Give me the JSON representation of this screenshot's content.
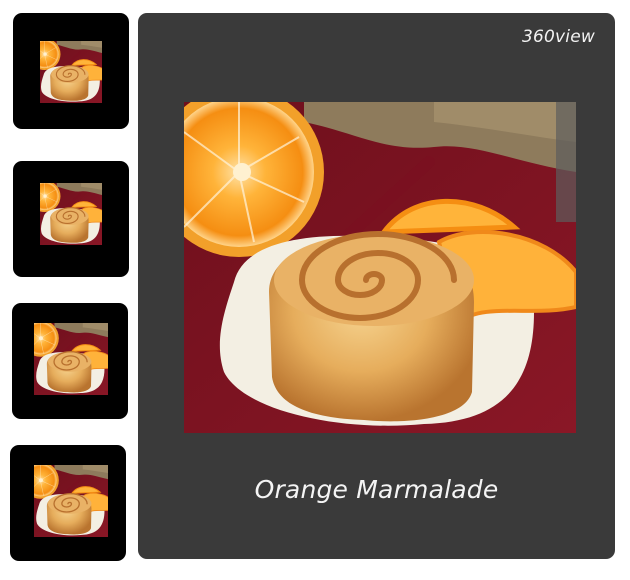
{
  "viewer": {
    "brand_label": "360view",
    "caption": "Orange Marmalade",
    "background_color": "#3a3a3a"
  },
  "thumbnails": [
    {
      "image": "orange-marmalade-roll-photo",
      "selected": false
    },
    {
      "image": "orange-marmalade-roll-photo",
      "selected": false
    },
    {
      "image": "orange-marmalade-roll-photo",
      "selected": false
    },
    {
      "image": "orange-marmalade-roll-photo",
      "selected": false
    }
  ],
  "main_image": {
    "subject": "orange-marmalade-roll-photo"
  }
}
